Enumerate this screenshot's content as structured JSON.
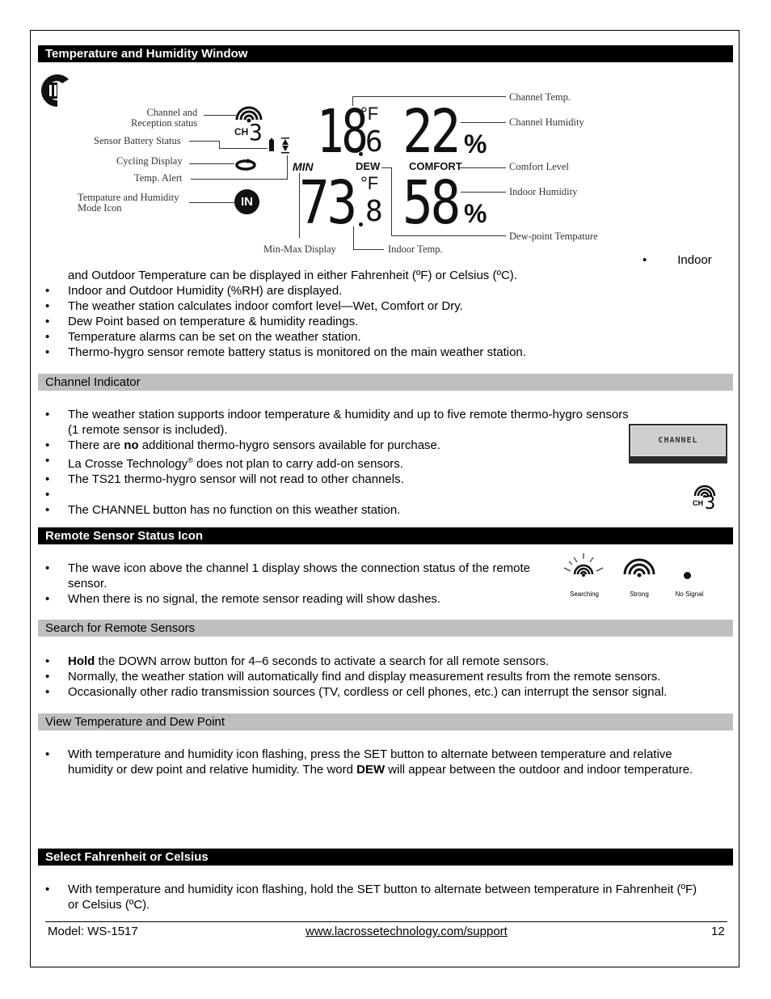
{
  "sections": {
    "temp_humidity": {
      "title": "Temperature and Humidity Window",
      "diagram": {
        "left_labels": {
          "channel_reception": [
            "Channel and",
            "Reception status"
          ],
          "sensor_battery": "Sensor Battery Status",
          "cycling_display": "Cycling Display",
          "temp_alert": "Temp. Alert",
          "mode_icon": [
            "Tempature and Humidity",
            "Mode Icon"
          ]
        },
        "right_labels": {
          "channel_temp": "Channel Temp.",
          "channel_humidity": "Channel Humidity",
          "comfort_level": "Comfort Level",
          "indoor_humidity": "Indoor Humidity",
          "dew_point": "Dew-point Tempature"
        },
        "bottom_labels": {
          "min_max": "Min-Max Display",
          "indoor_temp": "Indoor Temp."
        },
        "lcd": {
          "ch_label": "CH",
          "ch_number": "3",
          "channel_temp_int": "18",
          "channel_temp_dec": "6",
          "temp_unit": "°F",
          "channel_humidity": "22",
          "percent": "%",
          "min_label": "MIN",
          "dew_label": "DEW",
          "comfort_label": "COMFORT",
          "indoor_temp_int": "73",
          "indoor_temp_dec": "8",
          "indoor_humidity": "58",
          "in_badge": "IN"
        }
      },
      "bullets": {
        "first_lead": "Indoor",
        "first_rest": "and Outdoor Temperature can be displayed in either Fahrenheit (ºF) or Celsius (ºC).",
        "items": [
          "Indoor and Outdoor Humidity (%RH) are displayed.",
          "The weather station calculates indoor comfort level—Wet, Comfort or Dry.",
          "Dew Point based on temperature & humidity readings.",
          "Temperature alarms can be set on the weather station.",
          "Thermo-hygro sensor remote battery status is monitored on the main weather station."
        ]
      }
    },
    "channel_indicator": {
      "title": "Channel Indicator",
      "bullets": {
        "b1_line1": "The weather station supports indoor temperature & humidity and up to five remote thermo-hygro sensors",
        "b1_line2": "(1 remote sensor is included).",
        "b2_pre": "There are ",
        "b2_bold": "no",
        "b2_post": " additional thermo-hygro sensors available for purchase.",
        "b3_pre": "La Crosse Technology",
        "b3_sup": "®",
        "b3_post": " does not plan to carry add-on sensors.",
        "b4": "The TS21 thermo-hygro sensor will not read to other channels.",
        "b5": "",
        "b6": "The CHANNEL button has no function on this weather station."
      },
      "button_image_label": "CHANNEL",
      "ch_icon_label": "CH",
      "ch_icon_number": "3"
    },
    "remote_sensor": {
      "title": "Remote Sensor Status Icon",
      "bullets": {
        "b1_line1": "The wave icon above the channel 1 display shows the connection status of the remote",
        "b1_line2": "sensor.",
        "b2": "When there is no signal, the remote sensor reading will show dashes."
      },
      "status_icons": [
        {
          "icon": "searching-signal-icon",
          "label": "Searching"
        },
        {
          "icon": "strong-signal-icon",
          "label": "Strong"
        },
        {
          "icon": "no-signal-icon",
          "label": "No Signal"
        }
      ]
    },
    "search_sensors": {
      "title": "Search for Remote Sensors",
      "bullets": {
        "b1_bold": "Hold",
        "b1_rest": " the DOWN arrow button for 4–6 seconds to activate a search for all remote sensors.",
        "b2": "Normally, the weather station will automatically find and display measurement results from the remote sensors.",
        "b3": "Occasionally other radio transmission sources (TV, cordless or cell phones, etc.) can interrupt the sensor signal."
      }
    },
    "view_dew": {
      "title": "View Temperature and Dew Point",
      "bullets": {
        "b1_line1": "With temperature and humidity icon flashing, press the SET button to alternate between temperature and relative",
        "b1_line2_pre": "humidity or dew point and relative humidity. The word ",
        "b1_line2_bold": "DEW",
        "b1_line2_post": " will appear between the outdoor and indoor temperature."
      }
    },
    "fahrenheit_celsius": {
      "title": "Select Fahrenheit or Celsius",
      "bullets": {
        "b1_line1": "With temperature and humidity icon flashing, hold the SET button to alternate between temperature in Fahrenheit (ºF)",
        "b1_line2": "or Celsius (ºC)."
      }
    }
  },
  "footer": {
    "model": "Model: WS-1517",
    "url": "www.lacrossetechnology.com/support",
    "page_number": "12"
  }
}
